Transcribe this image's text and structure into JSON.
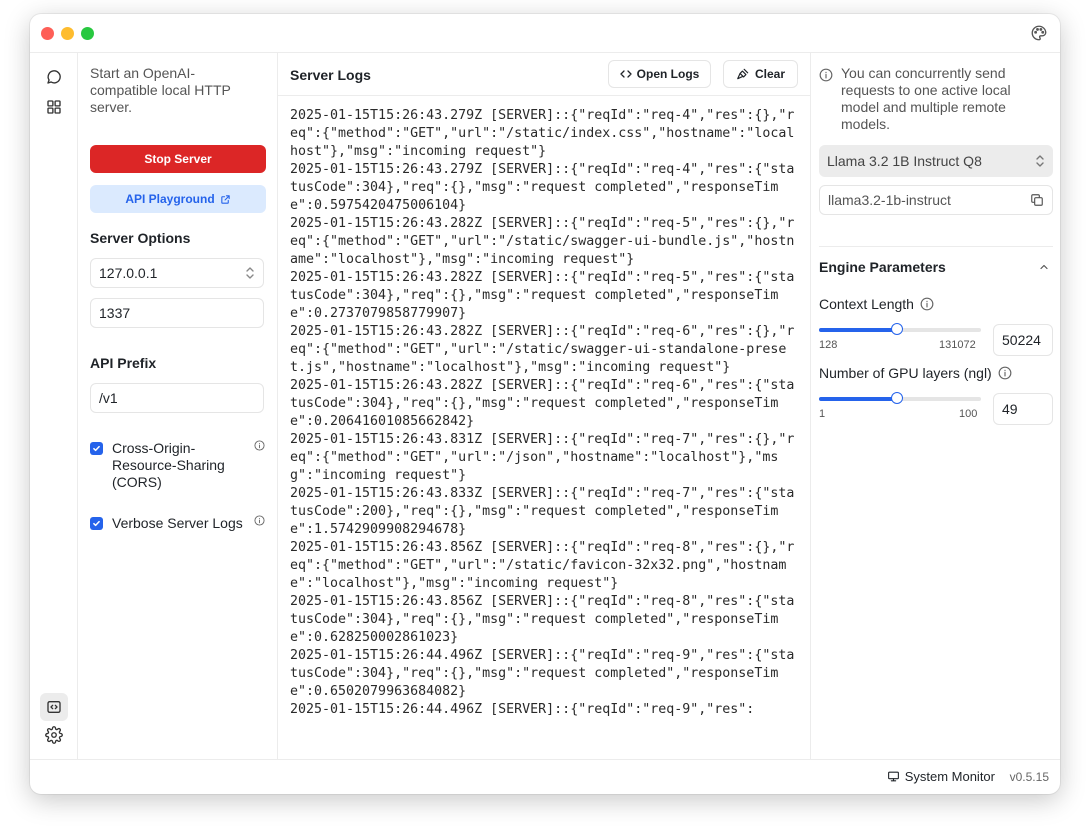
{
  "left_panel": {
    "intro": "Start an OpenAI-compatible local HTTP server.",
    "stop_button": "Stop Server",
    "playground_button": "API Playground",
    "server_options_title": "Server Options",
    "host_value": "127.0.0.1",
    "port_value": "1337",
    "api_prefix_title": "API Prefix",
    "api_prefix_value": "/v1",
    "cors_label": "Cross-Origin-Resource-Sharing (CORS)",
    "cors_checked": true,
    "verbose_label": "Verbose Server Logs",
    "verbose_checked": true
  },
  "logs_panel": {
    "title": "Server Logs",
    "open_logs_label": "Open Logs",
    "clear_label": "Clear",
    "lines": [
      "2025-01-15T15:26:43.279Z [SERVER]::{\"reqId\":\"req-4\",\"res\":{},\"req\":{\"method\":\"GET\",\"url\":\"/static/index.css\",\"hostname\":\"localhost\"},\"msg\":\"incoming request\"}",
      "2025-01-15T15:26:43.279Z [SERVER]::{\"reqId\":\"req-4\",\"res\":{\"statusCode\":304},\"req\":{},\"msg\":\"request completed\",\"responseTime\":0.5975420475006104}",
      "2025-01-15T15:26:43.282Z [SERVER]::{\"reqId\":\"req-5\",\"res\":{},\"req\":{\"method\":\"GET\",\"url\":\"/static/swagger-ui-bundle.js\",\"hostname\":\"localhost\"},\"msg\":\"incoming request\"}",
      "2025-01-15T15:26:43.282Z [SERVER]::{\"reqId\":\"req-5\",\"res\":{\"statusCode\":304},\"req\":{},\"msg\":\"request completed\",\"responseTime\":0.2737079858779907}",
      "2025-01-15T15:26:43.282Z [SERVER]::{\"reqId\":\"req-6\",\"res\":{},\"req\":{\"method\":\"GET\",\"url\":\"/static/swagger-ui-standalone-preset.js\",\"hostname\":\"localhost\"},\"msg\":\"incoming request\"}",
      "2025-01-15T15:26:43.282Z [SERVER]::{\"reqId\":\"req-6\",\"res\":{\"statusCode\":304},\"req\":{},\"msg\":\"request completed\",\"responseTime\":0.20641601085662842}",
      "2025-01-15T15:26:43.831Z [SERVER]::{\"reqId\":\"req-7\",\"res\":{},\"req\":{\"method\":\"GET\",\"url\":\"/json\",\"hostname\":\"localhost\"},\"msg\":\"incoming request\"}",
      "2025-01-15T15:26:43.833Z [SERVER]::{\"reqId\":\"req-7\",\"res\":{\"statusCode\":200},\"req\":{},\"msg\":\"request completed\",\"responseTime\":1.5742909908294678}",
      "2025-01-15T15:26:43.856Z [SERVER]::{\"reqId\":\"req-8\",\"res\":{},\"req\":{\"method\":\"GET\",\"url\":\"/static/favicon-32x32.png\",\"hostname\":\"localhost\"},\"msg\":\"incoming request\"}",
      "2025-01-15T15:26:43.856Z [SERVER]::{\"reqId\":\"req-8\",\"res\":{\"statusCode\":304},\"req\":{},\"msg\":\"request completed\",\"responseTime\":0.628250002861023}",
      "2025-01-15T15:26:44.496Z [SERVER]::{\"reqId\":\"req-9\",\"res\":{\"statusCode\":304},\"req\":{},\"msg\":\"request completed\",\"responseTime\":0.6502079963684082}",
      "2025-01-15T15:26:44.496Z [SERVER]::{\"reqId\":\"req-9\",\"res\":"
    ]
  },
  "right_panel": {
    "note": "You can concurrently send requests to one active local model and multiple remote models.",
    "model_name": "Llama 3.2 1B Instruct Q8",
    "model_id": "llama3.2-1b-instruct",
    "engine_title": "Engine Parameters",
    "context_label": "Context Length",
    "context_min": "128",
    "context_max": "131072",
    "context_value": "50224",
    "context_fraction": 0.48,
    "gpu_label": "Number of GPU layers (ngl)",
    "gpu_min": "1",
    "gpu_max": "100",
    "gpu_value": "49",
    "gpu_fraction": 0.48
  },
  "status_bar": {
    "system_monitor": "System Monitor",
    "version": "v0.5.15"
  },
  "colors": {
    "accent": "#2563eb",
    "danger": "#dc2626",
    "playground_bg": "#dbeafe"
  },
  "icons": {
    "titlebar": "palette-icon",
    "nav": [
      "chat-icon",
      "grid-icon",
      "code-icon",
      "settings-icon"
    ]
  }
}
